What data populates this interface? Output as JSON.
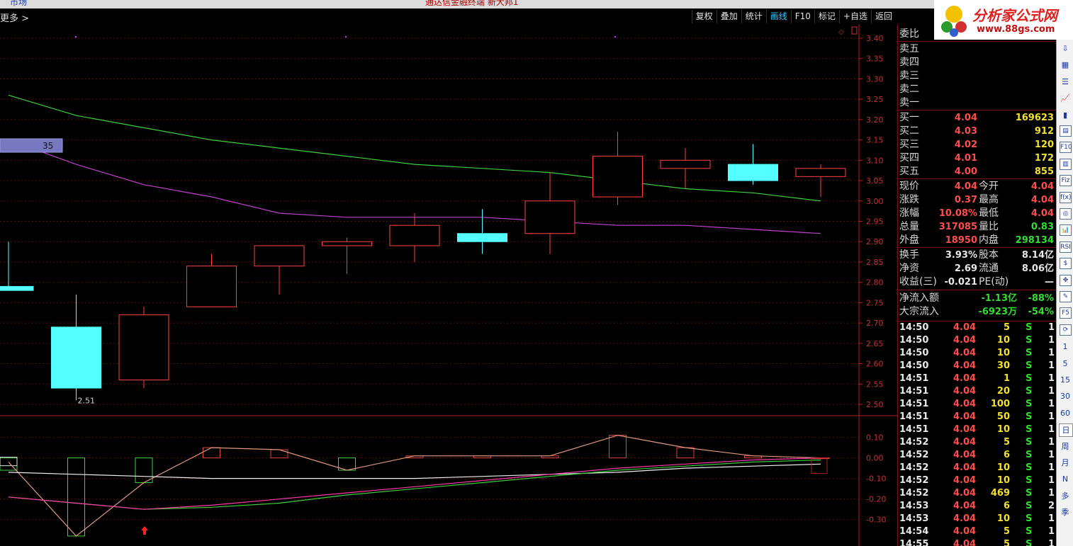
{
  "topbar": {
    "tab": "市场",
    "title": "通达信金融终端 新大邦1"
  },
  "toolbar": {
    "more_label": "更多 >",
    "buttons": [
      {
        "label": "复权",
        "active": false
      },
      {
        "label": "叠加",
        "active": false
      },
      {
        "label": "统计",
        "active": false
      },
      {
        "label": "画线",
        "active": true
      },
      {
        "label": "F10",
        "active": false
      },
      {
        "label": "标记",
        "active": false
      },
      {
        "label": "+自选",
        "active": false
      },
      {
        "label": "返回",
        "active": false
      }
    ]
  },
  "logo": {
    "title": "分析家公式网",
    "url_text": "www.88gs.com"
  },
  "chart_data": {
    "type": "candlestick",
    "price_axis": {
      "min": 2.5,
      "max": 3.4,
      "ticks": [
        "3.40",
        "3.35",
        "3.30",
        "3.25",
        "3.20",
        "3.15",
        "3.10",
        "3.05",
        "3.00",
        "2.95",
        "2.90",
        "2.85",
        "2.80",
        "2.75",
        "2.70",
        "2.65",
        "2.60",
        "2.55",
        "2.50"
      ]
    },
    "candles": [
      {
        "open": 2.79,
        "close": 2.78,
        "high": 2.9,
        "low": 2.78
      },
      {
        "open": 2.69,
        "close": 2.54,
        "high": 2.77,
        "low": 2.51
      },
      {
        "open": 2.56,
        "close": 2.72,
        "high": 2.74,
        "low": 2.54
      },
      {
        "open": 2.74,
        "close": 2.84,
        "high": 2.87,
        "low": 2.74
      },
      {
        "open": 2.84,
        "close": 2.89,
        "high": 2.89,
        "low": 2.77
      },
      {
        "open": 2.89,
        "close": 2.9,
        "high": 2.91,
        "low": 2.82
      },
      {
        "open": 2.89,
        "close": 2.94,
        "high": 2.97,
        "low": 2.85
      },
      {
        "open": 2.92,
        "close": 2.9,
        "high": 2.98,
        "low": 2.87
      },
      {
        "open": 2.92,
        "close": 3.0,
        "high": 3.07,
        "low": 2.87
      },
      {
        "open": 3.01,
        "close": 3.11,
        "high": 3.17,
        "low": 2.99
      },
      {
        "open": 3.08,
        "close": 3.1,
        "high": 3.13,
        "low": 3.03
      },
      {
        "open": 3.09,
        "close": 3.05,
        "high": 3.14,
        "low": 3.04
      },
      {
        "open": 3.06,
        "close": 3.08,
        "high": 3.09,
        "low": 3.01
      }
    ],
    "ma_green": [
      3.26,
      3.21,
      3.18,
      3.15,
      3.13,
      3.11,
      3.09,
      3.08,
      3.07,
      3.05,
      3.03,
      3.02,
      3.0
    ],
    "ma_purple": [
      3.15,
      3.09,
      3.04,
      3.01,
      2.97,
      2.96,
      2.96,
      2.96,
      2.95,
      2.94,
      2.94,
      2.93,
      2.92
    ],
    "low_label": "2.51",
    "tag_value": "35",
    "indicator": {
      "ticks": [
        "0.10",
        "0.00",
        "-0.10",
        "-0.20",
        "-0.30"
      ],
      "min": -0.37,
      "max": 0.14,
      "bars": [
        -0.06,
        -0.38,
        -0.12,
        0.05,
        0.04,
        -0.06,
        0.01,
        0.01,
        0.01,
        0.11,
        0.05,
        0.01,
        0.0
      ],
      "line_orange": [
        -0.02,
        -0.38,
        -0.12,
        0.05,
        0.04,
        -0.06,
        0.01,
        0.01,
        0.01,
        0.11,
        0.05,
        0.01,
        0.0
      ],
      "line_white": [
        -0.07,
        -0.08,
        -0.09,
        -0.1,
        -0.1,
        -0.1,
        -0.1,
        -0.09,
        -0.08,
        -0.07,
        -0.05,
        -0.04,
        -0.03
      ],
      "line_magenta": [
        -0.19,
        -0.22,
        -0.25,
        -0.23,
        -0.2,
        -0.17,
        -0.14,
        -0.11,
        -0.08,
        -0.05,
        -0.03,
        -0.01,
        0.0
      ],
      "line_green": [
        -0.19,
        -0.22,
        -0.25,
        -0.24,
        -0.22,
        -0.18,
        -0.15,
        -0.12,
        -0.09,
        -0.06,
        -0.04,
        -0.02,
        -0.01
      ]
    }
  },
  "panel": {
    "weibi_label": "委比",
    "sells": [
      {
        "label": "卖五",
        "price": "",
        "vol": ""
      },
      {
        "label": "卖四",
        "price": "",
        "vol": ""
      },
      {
        "label": "卖三",
        "price": "",
        "vol": ""
      },
      {
        "label": "卖二",
        "price": "",
        "vol": ""
      },
      {
        "label": "卖一",
        "price": "",
        "vol": ""
      }
    ],
    "buys": [
      {
        "label": "买一",
        "price": "4.04",
        "vol": "169623"
      },
      {
        "label": "买二",
        "price": "4.03",
        "vol": "912"
      },
      {
        "label": "买三",
        "price": "4.02",
        "vol": "120"
      },
      {
        "label": "买四",
        "price": "4.01",
        "vol": "172"
      },
      {
        "label": "买五",
        "price": "4.00",
        "vol": "855"
      }
    ],
    "quote": [
      {
        "l1": "现价",
        "v1": "4.04",
        "l2": "今开",
        "v2": "4.04",
        "c2": "#ff4d4d"
      },
      {
        "l1": "涨跌",
        "v1": "0.37",
        "l2": "最高",
        "v2": "4.04",
        "c2": "#ff4d4d"
      },
      {
        "l1": "涨幅",
        "v1": "10.08%",
        "l2": "最低",
        "v2": "4.04",
        "c2": "#ff4d4d"
      },
      {
        "l1": "总量",
        "v1": "317085",
        "l2": "量比",
        "v2": "0.83",
        "c2": "#33dd33"
      },
      {
        "l1": "外盘",
        "v1": "18950",
        "l2": "内盘",
        "v2": "298134",
        "c2": "#33dd33"
      }
    ],
    "quote2": [
      {
        "l1": "换手",
        "v1": "3.93%",
        "l2": "股本",
        "v2": "8.14亿"
      },
      {
        "l1": "净资",
        "v1": "2.69",
        "l2": "流通",
        "v2": "8.06亿"
      },
      {
        "l1": "收益(三)",
        "v1": "-0.021",
        "l2": "PE(动)",
        "v2": "—"
      }
    ],
    "flow": [
      {
        "label": "净流入额",
        "v1": "-1.13亿",
        "v2": "-88%"
      },
      {
        "label": "大宗流入",
        "v1": "-6923万",
        "v2": "-54%"
      }
    ],
    "ticks": [
      {
        "t": "14:50",
        "p": "4.04",
        "v": "5",
        "s": "S",
        "n": "1"
      },
      {
        "t": "14:50",
        "p": "4.04",
        "v": "10",
        "s": "S",
        "n": "1"
      },
      {
        "t": "14:50",
        "p": "4.04",
        "v": "10",
        "s": "S",
        "n": "1"
      },
      {
        "t": "14:50",
        "p": "4.04",
        "v": "30",
        "s": "S",
        "n": "1"
      },
      {
        "t": "14:51",
        "p": "4.04",
        "v": "1",
        "s": "S",
        "n": "1"
      },
      {
        "t": "14:51",
        "p": "4.04",
        "v": "20",
        "s": "S",
        "n": "1"
      },
      {
        "t": "14:51",
        "p": "4.04",
        "v": "100",
        "s": "S",
        "n": "1"
      },
      {
        "t": "14:51",
        "p": "4.04",
        "v": "50",
        "s": "S",
        "n": "1"
      },
      {
        "t": "14:51",
        "p": "4.04",
        "v": "10",
        "s": "S",
        "n": "1"
      },
      {
        "t": "14:52",
        "p": "4.04",
        "v": "5",
        "s": "S",
        "n": "1"
      },
      {
        "t": "14:52",
        "p": "4.04",
        "v": "6",
        "s": "S",
        "n": "1"
      },
      {
        "t": "14:52",
        "p": "4.04",
        "v": "10",
        "s": "S",
        "n": "1"
      },
      {
        "t": "14:52",
        "p": "4.04",
        "v": "10",
        "s": "S",
        "n": "1"
      },
      {
        "t": "14:52",
        "p": "4.04",
        "v": "469",
        "s": "S",
        "n": "1"
      },
      {
        "t": "14:53",
        "p": "4.04",
        "v": "6",
        "s": "S",
        "n": "2"
      },
      {
        "t": "14:53",
        "p": "4.04",
        "v": "10",
        "s": "S",
        "n": "1"
      },
      {
        "t": "14:54",
        "p": "4.04",
        "v": "5",
        "s": "S",
        "n": "1"
      },
      {
        "t": "14:55",
        "p": "4.04",
        "v": "5",
        "s": "S",
        "n": "1"
      }
    ]
  },
  "rightbar": [
    {
      "icon": "arrow-down-icon",
      "glyph": "⇩"
    },
    {
      "icon": "grid-icon",
      "glyph": "▦"
    },
    {
      "icon": "list-icon",
      "glyph": "☰"
    },
    {
      "icon": "line-chart-icon",
      "glyph": "📈"
    },
    {
      "icon": "candle-icon",
      "glyph": "▮"
    },
    {
      "icon": "doc-icon",
      "glyph": "▤"
    },
    {
      "icon": "f10-icon",
      "glyph": "F10"
    },
    {
      "icon": "table-icon",
      "glyph": "▥"
    },
    {
      "icon": "fiz-icon",
      "glyph": "Fiz"
    },
    {
      "icon": "fx-icon",
      "glyph": "f(x)"
    },
    {
      "icon": "circle-icon",
      "glyph": "◎"
    },
    {
      "icon": "chart-icon",
      "glyph": "📊"
    },
    {
      "icon": "rsi-icon",
      "glyph": "RSI"
    },
    {
      "icon": "dollar-icon",
      "glyph": "$"
    },
    {
      "icon": "move-icon",
      "glyph": "✥"
    },
    {
      "icon": "pen-icon",
      "glyph": "✎"
    },
    {
      "icon": "f5-icon",
      "glyph": "F5"
    },
    {
      "icon": "refresh-icon",
      "glyph": "⟳"
    },
    {
      "icon": "period-1-icon",
      "glyph": "1"
    },
    {
      "icon": "period-5-icon",
      "glyph": "5"
    },
    {
      "icon": "period-15-icon",
      "glyph": "15"
    },
    {
      "icon": "period-30-icon",
      "glyph": "30"
    },
    {
      "icon": "period-60-icon",
      "glyph": "60"
    },
    {
      "icon": "period-day-icon",
      "glyph": "日"
    },
    {
      "icon": "period-week-icon",
      "glyph": "周"
    },
    {
      "icon": "period-month-icon",
      "glyph": "月"
    },
    {
      "icon": "period-n-icon",
      "glyph": "N"
    },
    {
      "icon": "period-multi-icon",
      "glyph": "多"
    },
    {
      "icon": "period-season-icon",
      "glyph": "季"
    }
  ]
}
